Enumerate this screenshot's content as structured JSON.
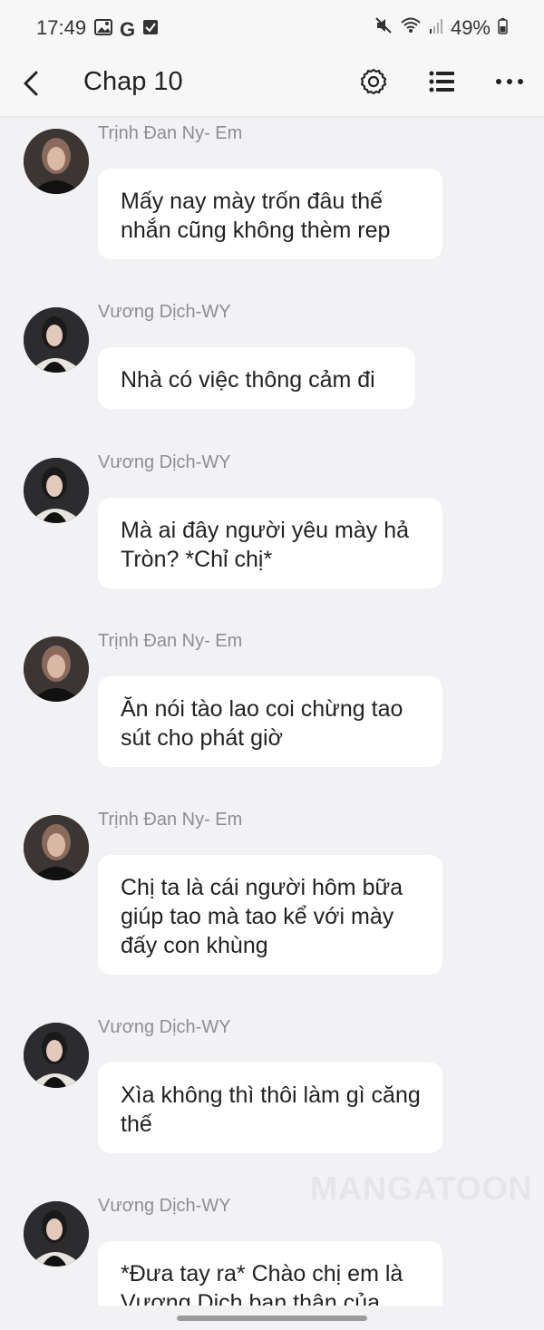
{
  "status_bar": {
    "time": "17:49",
    "battery": "49%",
    "left_icons": [
      "gallery-icon",
      "google-icon",
      "checkbox-icon"
    ],
    "right_icons": [
      "mute-icon",
      "wifi-icon",
      "signal-icon",
      "battery-icon"
    ]
  },
  "app_bar": {
    "title": "Chap 10",
    "icons": [
      "back-arrow-icon",
      "gear-icon",
      "list-icon",
      "more-icon"
    ]
  },
  "messages": [
    {
      "sender": "Trịnh Đan Ny- Em",
      "text": "Mấy nay mày trốn đâu thế nhắn cũng không thèm rep"
    },
    {
      "sender": "Vương Dịch-WY",
      "text": "Nhà có việc thông cảm đi"
    },
    {
      "sender": "Vương Dịch-WY",
      "text": "Mà ai đây người yêu mày hả Tròn? *Chỉ chị*"
    },
    {
      "sender": "Trịnh Đan Ny- Em",
      "text": "Ăn nói tào lao coi chừng tao sút cho phát giờ"
    },
    {
      "sender": "Trịnh Đan Ny- Em",
      "text": "Chị ta là cái người hôm bữa giúp tao mà tao kể với mày đấy con khùng"
    },
    {
      "sender": "Vương Dịch-WY",
      "text": "Xìa không thì thôi làm gì căng thế"
    },
    {
      "sender": "Vương Dịch-WY",
      "text": "*Đưa tay ra* Chào chị em là Vương Dịch bạn thân của"
    }
  ],
  "watermark": "MANGATOON",
  "colors": {
    "background": "#f2f2f4",
    "bubble": "#ffffff",
    "sender": "#8e8e93",
    "text": "#222222"
  }
}
